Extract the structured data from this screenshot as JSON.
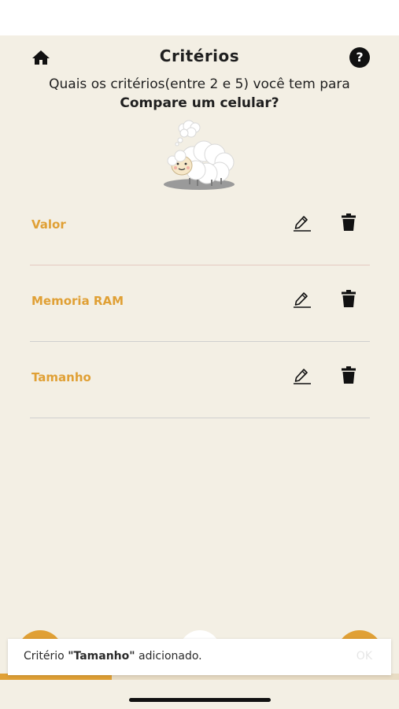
{
  "header": {
    "title": "Critérios"
  },
  "question": {
    "line1": "Quais os critérios(entre 2 e 5) você tem para",
    "line2": "Compare um celular?"
  },
  "criteria": [
    {
      "label": "Valor"
    },
    {
      "label": "Memoria RAM"
    },
    {
      "label": "Tamanho"
    }
  ],
  "toast": {
    "prefix": "Critério ",
    "name": "\"Tamanho\"",
    "suffix": " adicionado.",
    "ok": "OK"
  },
  "progress": {
    "fraction": 0.28
  },
  "colors": {
    "accent": "#e0a035",
    "background": "#f3efe4"
  },
  "icons": {
    "home": "home-icon",
    "help": "help-icon",
    "edit": "pencil-icon",
    "delete": "trash-icon"
  }
}
